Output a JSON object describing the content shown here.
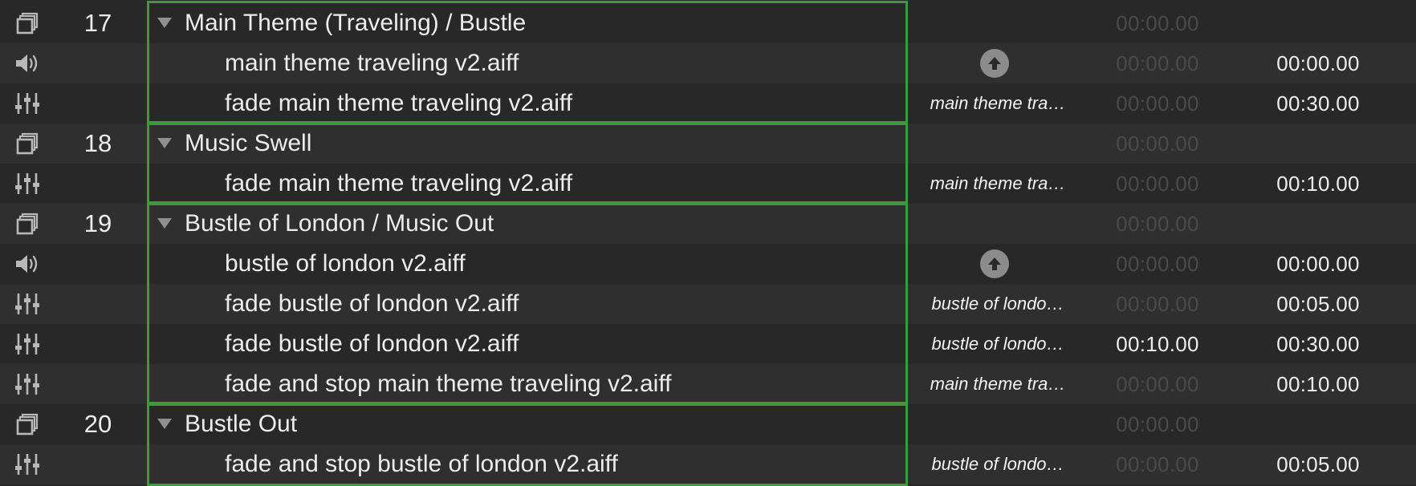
{
  "colors": {
    "background_dark": "#282828",
    "background_light": "#2f2f2f",
    "group_border": "#3a9a3e",
    "text": "#ececec",
    "dim_time": "#4a4a4a",
    "icon": "#b8b8b8"
  },
  "rows": [
    {
      "kind": "group",
      "icon": "group-icon",
      "number": "17",
      "name": "Main Theme (Traveling) / Bustle",
      "target": "",
      "prewait": "00:00.00",
      "prewait_active": false,
      "duration": ""
    },
    {
      "kind": "child",
      "icon": "audio-icon",
      "number": "",
      "name": "main theme traveling v2.aiff",
      "target": "",
      "target_badge": true,
      "prewait": "00:00.00",
      "prewait_active": false,
      "duration": "00:00.00"
    },
    {
      "kind": "child",
      "icon": "fade-icon",
      "number": "",
      "name": "fade main theme traveling v2.aiff",
      "target": "main theme tra…",
      "prewait": "00:00.00",
      "prewait_active": false,
      "duration": "00:30.00"
    },
    {
      "kind": "group",
      "icon": "group-icon",
      "number": "18",
      "name": "Music Swell",
      "target": "",
      "prewait": "00:00.00",
      "prewait_active": false,
      "duration": ""
    },
    {
      "kind": "child",
      "icon": "fade-icon",
      "number": "",
      "name": "fade main theme traveling v2.aiff",
      "target": "main theme tra…",
      "prewait": "00:00.00",
      "prewait_active": false,
      "duration": "00:10.00"
    },
    {
      "kind": "group",
      "icon": "group-icon",
      "number": "19",
      "name": "Bustle of London / Music Out",
      "target": "",
      "prewait": "00:00.00",
      "prewait_active": false,
      "duration": ""
    },
    {
      "kind": "child",
      "icon": "audio-icon",
      "number": "",
      "name": "bustle of london v2.aiff",
      "target": "",
      "target_badge": true,
      "prewait": "00:00.00",
      "prewait_active": false,
      "duration": "00:00.00"
    },
    {
      "kind": "child",
      "icon": "fade-icon",
      "number": "",
      "name": "fade bustle of london v2.aiff",
      "target": "bustle of londo…",
      "prewait": "00:00.00",
      "prewait_active": false,
      "duration": "00:05.00"
    },
    {
      "kind": "child",
      "icon": "fade-icon",
      "number": "",
      "name": "fade bustle of london v2.aiff",
      "target": "bustle of londo…",
      "prewait": "00:10.00",
      "prewait_active": true,
      "duration": "00:30.00"
    },
    {
      "kind": "child",
      "icon": "fade-icon",
      "number": "",
      "name": "fade and stop main theme traveling v2.aiff",
      "target": "main theme tra…",
      "prewait": "00:00.00",
      "prewait_active": false,
      "duration": "00:10.00"
    },
    {
      "kind": "group",
      "icon": "group-icon",
      "number": "20",
      "name": "Bustle Out",
      "target": "",
      "prewait": "00:00.00",
      "prewait_active": false,
      "duration": ""
    },
    {
      "kind": "child",
      "icon": "fade-icon",
      "number": "",
      "name": "fade and stop bustle of london v2.aiff",
      "target": "bustle of londo…",
      "prewait": "00:00.00",
      "prewait_active": false,
      "duration": "00:05.00"
    }
  ]
}
